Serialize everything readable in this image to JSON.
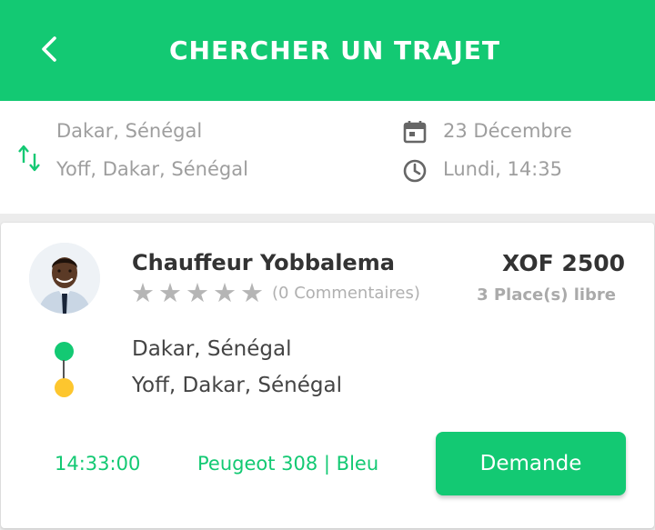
{
  "header": {
    "title": "CHERCHER UN TRAJET",
    "back_icon": "arrow-left-icon"
  },
  "search": {
    "from": "Dakar, Sénégal",
    "to": "Yoff, Dakar, Sénégal",
    "date": "23 Décembre",
    "time": "Lundi, 14:35",
    "swap_icon": "swap-vertical-icon",
    "date_icon": "calendar-icon",
    "time_icon": "clock-icon"
  },
  "ride": {
    "driver_name": "Chauffeur Yobbalema",
    "rating_stars": 0,
    "rating_max": 5,
    "comments": "(0 Commentaires)",
    "price": "XOF 2500",
    "places": "3 Place(s) libre",
    "from": "Dakar, Sénégal",
    "to": "Yoff, Dakar, Sénégal",
    "departure_time": "14:33:00",
    "vehicle": "Peugeot 308 | Bleu",
    "request_label": "Demande"
  },
  "colors": {
    "accent": "#13c973",
    "destination_dot": "#fdc62e",
    "muted_text": "#9e9e9e"
  }
}
